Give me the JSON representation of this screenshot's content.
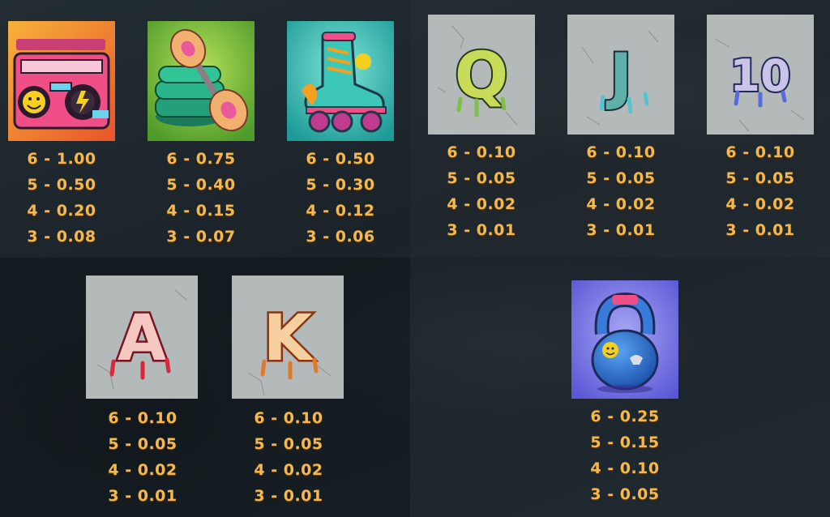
{
  "symbols": [
    {
      "name": "boombox",
      "pays": [
        {
          "count": "6",
          "value": "1.00"
        },
        {
          "count": "5",
          "value": "0.50"
        },
        {
          "count": "4",
          "value": "0.20"
        },
        {
          "count": "3",
          "value": "0.08"
        }
      ]
    },
    {
      "name": "dumbbell",
      "pays": [
        {
          "count": "6",
          "value": "0.75"
        },
        {
          "count": "5",
          "value": "0.40"
        },
        {
          "count": "4",
          "value": "0.15"
        },
        {
          "count": "3",
          "value": "0.07"
        }
      ]
    },
    {
      "name": "roller-skate",
      "pays": [
        {
          "count": "6",
          "value": "0.50"
        },
        {
          "count": "5",
          "value": "0.30"
        },
        {
          "count": "4",
          "value": "0.12"
        },
        {
          "count": "3",
          "value": "0.06"
        }
      ]
    },
    {
      "name": "letter-q",
      "letter": "Q",
      "pays": [
        {
          "count": "6",
          "value": "0.10"
        },
        {
          "count": "5",
          "value": "0.05"
        },
        {
          "count": "4",
          "value": "0.02"
        },
        {
          "count": "3",
          "value": "0.01"
        }
      ]
    },
    {
      "name": "letter-j",
      "letter": "J",
      "pays": [
        {
          "count": "6",
          "value": "0.10"
        },
        {
          "count": "5",
          "value": "0.05"
        },
        {
          "count": "4",
          "value": "0.02"
        },
        {
          "count": "3",
          "value": "0.01"
        }
      ]
    },
    {
      "name": "number-10",
      "letter": "10",
      "pays": [
        {
          "count": "6",
          "value": "0.10"
        },
        {
          "count": "5",
          "value": "0.05"
        },
        {
          "count": "4",
          "value": "0.02"
        },
        {
          "count": "3",
          "value": "0.01"
        }
      ]
    },
    {
      "name": "letter-a",
      "letter": "A",
      "pays": [
        {
          "count": "6",
          "value": "0.10"
        },
        {
          "count": "5",
          "value": "0.05"
        },
        {
          "count": "4",
          "value": "0.02"
        },
        {
          "count": "3",
          "value": "0.01"
        }
      ]
    },
    {
      "name": "letter-k",
      "letter": "K",
      "pays": [
        {
          "count": "6",
          "value": "0.10"
        },
        {
          "count": "5",
          "value": "0.05"
        },
        {
          "count": "4",
          "value": "0.02"
        },
        {
          "count": "3",
          "value": "0.01"
        }
      ]
    },
    {
      "name": "kettlebell",
      "pays": [
        {
          "count": "6",
          "value": "0.25"
        },
        {
          "count": "5",
          "value": "0.15"
        },
        {
          "count": "4",
          "value": "0.10"
        },
        {
          "count": "3",
          "value": "0.05"
        }
      ]
    }
  ],
  "separator": "-",
  "colors": {
    "payout_text": "#f5b84a",
    "background": "#1c242b"
  }
}
